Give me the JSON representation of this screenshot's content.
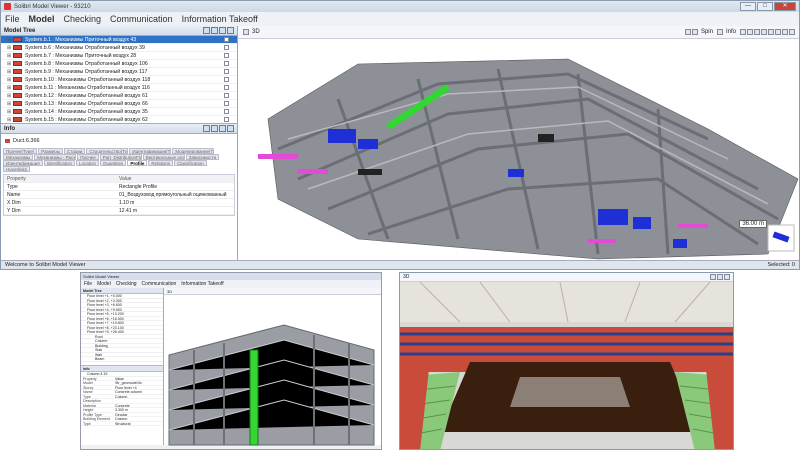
{
  "main_window": {
    "title": "Solibri Model Viewer - 93210",
    "window_controls": [
      "—",
      "□",
      "✕"
    ],
    "menu": [
      "File",
      "Model",
      "Checking",
      "Communication",
      "Information Takeoff"
    ],
    "active_menu": "Model",
    "model_tree": {
      "title": "Model Tree",
      "rows": [
        {
          "label": "System.b.1 : Механизмы Приточный воздух 43",
          "selected": true
        },
        {
          "label": "System.b.6 : Механизмы Отработанный воздух 39",
          "selected": false
        },
        {
          "label": "System.b.7 : Механизмы Приточный воздух 28",
          "selected": false
        },
        {
          "label": "System.b.8 : Механизмы Отработанный воздух 106",
          "selected": false
        },
        {
          "label": "System.b.9 : Механизмы Отработанный воздух 117",
          "selected": false
        },
        {
          "label": "System.b.10 : Механизмы Отработанный воздух 118",
          "selected": false
        },
        {
          "label": "System.b.11 : Механизмы Отработанный воздух 116",
          "selected": false
        },
        {
          "label": "System.b.12 : Механизмы Отработанный воздух 61",
          "selected": false
        },
        {
          "label": "System.b.13 : Механизмы Отработанный воздух 66",
          "selected": false
        },
        {
          "label": "System.b.14 : Механизмы Отработанный воздух 35",
          "selected": false
        },
        {
          "label": "System.b.15 : Механизмы Отработанный воздух 62",
          "selected": false
        }
      ]
    },
    "info": {
      "title": "Info",
      "object_name": "Duct.6.366",
      "tabs": [
        "Прочее(Type)",
        "Размеры",
        "Стадии",
        "Строительство(Type)",
        "Идентификация(Type)",
        "Моделирование(Type)",
        "Механизмы",
        "Механизмы - Расход",
        "Прочее",
        "Part_DistributionFlowElementCommon",
        "Вертикальные ограничения",
        "Зависимости",
        "Идентификация",
        "Identification",
        "Location",
        "Quantities",
        "Profile",
        "Relations",
        "Classification",
        "Hyperlinks"
      ],
      "active_tab": "Profile",
      "table_header": {
        "property": "Property",
        "value": "Value"
      },
      "properties": [
        {
          "k": "Type",
          "v": "Rectangle Profile"
        },
        {
          "k": "Name",
          "v": "01_Воздуховод прямоугольный оцинкованный"
        },
        {
          "k": "X Dim",
          "v": "1.10 m"
        },
        {
          "k": "Y Dim",
          "v": "12.41 m"
        }
      ]
    },
    "view": {
      "label": "3D",
      "toolbar": [
        "Spin",
        "Info"
      ],
      "scale_label": "36.00 m"
    },
    "status": {
      "left": "Welcome to Solibri Model Viewer",
      "right": "Selected: 0"
    }
  },
  "small_window": {
    "title": "Solibri Model Viewer",
    "menu": [
      "File",
      "Model",
      "Checking",
      "Communication",
      "Information Takeoff"
    ],
    "tree_title": "Model Tree",
    "tree_rows": [
      "Floor level +1, +0.000",
      "Floor level +2, +3.300",
      "Floor level +3, +6.600",
      "Floor level +4, +9.900",
      "Floor level +5, +13.200",
      "Floor level +6, +16.500",
      "Floor level +7, +19.800",
      "Floor level +8, +23.100",
      "Floor level +9, +26.400",
      "Roof",
      "Column",
      "Building",
      "Slab",
      "Wall",
      "Beam"
    ],
    "info_title": "Info",
    "info_object": "Column.4.19",
    "properties": [
      {
        "k": "Property",
        "v": "Value"
      },
      {
        "k": "Model",
        "v": "Str_geomodel.ifc"
      },
      {
        "k": "Storey",
        "v": "Floor level +4"
      },
      {
        "k": "Name",
        "v": "Concrete column"
      },
      {
        "k": "Type",
        "v": "Column"
      },
      {
        "k": "Description",
        "v": ""
      },
      {
        "k": "Material",
        "v": "Concrete"
      },
      {
        "k": "Height",
        "v": "3.300 m"
      },
      {
        "k": "Profile Type",
        "v": "Circular"
      },
      {
        "k": "Building Element",
        "v": "Column"
      },
      {
        "k": "Type",
        "v": "Structural"
      }
    ],
    "view_label": "3D"
  },
  "arena_window": {
    "view_label": "3D"
  },
  "colors": {
    "selection": "#2e72c8",
    "highlight_green": "#33d633",
    "duct_blue": "#1e2fd6",
    "duct_magenta": "#e34bd6",
    "arena_floor": "#3a1f0e"
  }
}
